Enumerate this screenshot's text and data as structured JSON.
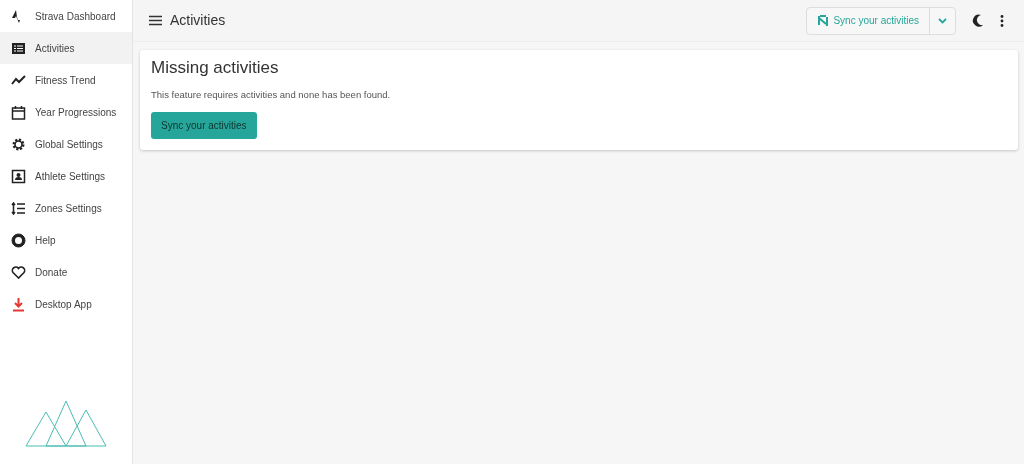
{
  "sidebar": {
    "items": [
      {
        "label": "Strava Dashboard",
        "selected": false
      },
      {
        "label": "Activities",
        "selected": true
      },
      {
        "label": "Fitness Trend",
        "selected": false
      },
      {
        "label": "Year Progressions",
        "selected": false
      },
      {
        "label": "Global Settings",
        "selected": false
      },
      {
        "label": "Athlete Settings",
        "selected": false
      },
      {
        "label": "Zones Settings",
        "selected": false
      },
      {
        "label": "Help",
        "selected": false
      },
      {
        "label": "Donate",
        "selected": false
      },
      {
        "label": "Desktop App",
        "selected": false
      }
    ]
  },
  "toolbar": {
    "title": "Activities",
    "sync_button": "Sync your activities"
  },
  "card": {
    "title": "Missing activities",
    "message": "This feature requires activities and none has been found.",
    "button": "Sync your activities"
  }
}
